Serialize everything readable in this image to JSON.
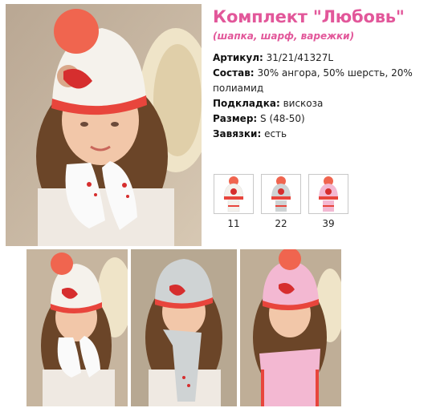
{
  "product": {
    "title": "Комплект \"Любовь\"",
    "subtitle": "(шапка, шарф, варежки)"
  },
  "properties": [
    {
      "key": "Артикул:",
      "value": "31/21/41327L"
    },
    {
      "key": "Состав:",
      "value": "30% ангора, 50% шерсть, 20% полиамид"
    },
    {
      "key": "Подкладка:",
      "value": "вискоза"
    },
    {
      "key": "Размер:",
      "value": "S (48-50)"
    },
    {
      "key": "Завязки:",
      "value": "есть"
    }
  ],
  "colors": [
    {
      "code": "11",
      "hat": "#f4f1ec",
      "accent": "#e8453c"
    },
    {
      "code": "22",
      "hat": "#cfd3d4",
      "accent": "#e8453c"
    },
    {
      "code": "39",
      "hat": "#f3b8d2",
      "accent": "#e8453c"
    }
  ],
  "theme": {
    "accent": "#e2579a",
    "pompom": "#f0654f"
  }
}
